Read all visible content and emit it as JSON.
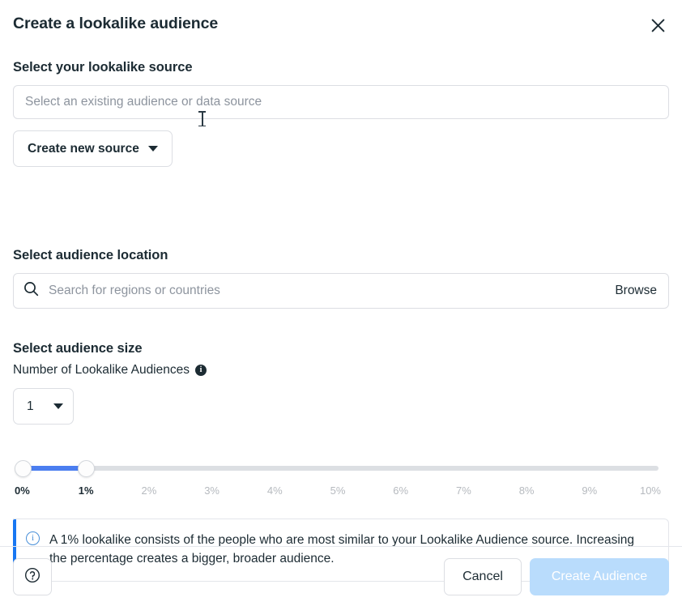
{
  "dialog": {
    "title": "Create a lookalike audience",
    "close_icon": "close-icon"
  },
  "source_section": {
    "title": "Select your lookalike source",
    "input_placeholder": "Select an existing audience or data source",
    "create_button_label": "Create new source",
    "caret_icon": "chevron-down-icon"
  },
  "location_section": {
    "title": "Select audience location",
    "search_icon": "search-icon",
    "search_placeholder": "Search for regions or countries",
    "browse_label": "Browse"
  },
  "size_section": {
    "title": "Select audience size",
    "count_label": "Number of Lookalike Audiences",
    "count_info_icon": "info-icon",
    "count_value": "1",
    "count_caret_icon": "chevron-down-icon"
  },
  "slider": {
    "min_value": "0%",
    "max_value": "1%",
    "range_min": 0,
    "range_max": 10,
    "selected_start": 0,
    "selected_end": 1,
    "fill_color": "#4b7ef0",
    "track_color": "#dcdfe3",
    "ticks": [
      {
        "label": "0%",
        "value": 0,
        "active": true
      },
      {
        "label": "1%",
        "value": 1,
        "active": true
      },
      {
        "label": "2%",
        "value": 2,
        "active": false
      },
      {
        "label": "3%",
        "value": 3,
        "active": false
      },
      {
        "label": "4%",
        "value": 4,
        "active": false
      },
      {
        "label": "5%",
        "value": 5,
        "active": false
      },
      {
        "label": "6%",
        "value": 6,
        "active": false
      },
      {
        "label": "7%",
        "value": 7,
        "active": false
      },
      {
        "label": "8%",
        "value": 8,
        "active": false
      },
      {
        "label": "9%",
        "value": 9,
        "active": false
      },
      {
        "label": "10%",
        "value": 10,
        "active": false
      }
    ]
  },
  "info_banner": {
    "icon": "info-circle-icon",
    "text": "A 1% lookalike consists of the people who are most similar to your Lookalike Audience source. Increasing the percentage creates a bigger, broader audience.",
    "accent_color": "#1877f2"
  },
  "footer": {
    "help_icon": "question-circle-icon",
    "cancel_label": "Cancel",
    "submit_label": "Create Audience",
    "submit_disabled_color": "#b9dcfc"
  }
}
